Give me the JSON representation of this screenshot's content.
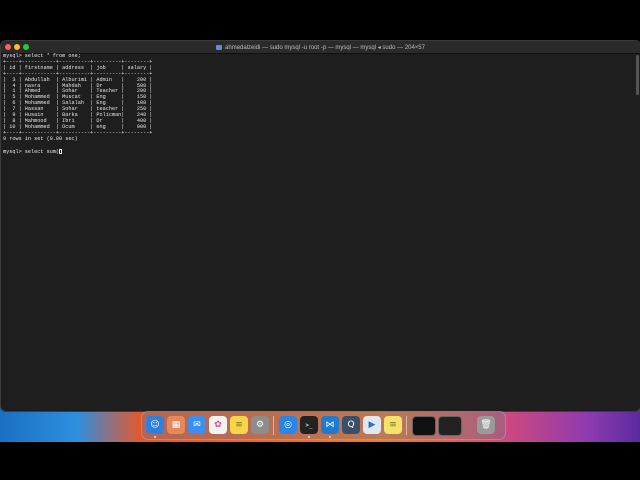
{
  "window": {
    "title": "ahmedalzeidi — sudo mysql -u root -p — mysql — mysql ◂ sudo — 204×57"
  },
  "terminal": {
    "lines": [
      "mysql> select * from one;",
      "+----+-----------+----------+---------+--------+",
      "| id | firstname | address  | job     | salary |",
      "+----+-----------+----------+---------+--------+",
      "|  3 | Abdullah  | Alburimi | Admin   |    200 |",
      "|  4 | nasra     | Mahdah   | Dr      |    500 |",
      "|  1 | Ahmed     | Sohar    | Teacher |    200 |",
      "|  5 | Mohammed  | Muscat   | Eng     |    150 |",
      "|  6 | Mohammed  | Salalah  | Eng     |    100 |",
      "|  7 | Hassan    | Sohar    | teacher |    250 |",
      "|  9 | Husain    | Barka    | Policman|    240 |",
      "|  8 | Mahmood   | Ibri     | Dr      |    400 |",
      "| 10 | Mohammed  | Dcum     | eng     |    900 |",
      "+----+-----------+----------+---------+--------+",
      "9 rows in set (0.00 sec)",
      "",
      "mysql> select sum("
    ]
  },
  "colors": {
    "terminal_bg": "#1e1e1e",
    "terminal_fg": "#e6e6e6",
    "close": "#ff5f57",
    "minimize": "#febc2e",
    "maximize": "#28c840"
  },
  "dock": {
    "items": [
      {
        "icon": "finder-icon",
        "color": "#2f7fe0",
        "glyph": "☺"
      },
      {
        "icon": "launchpad-icon",
        "color": "#e8875a",
        "glyph": "▦"
      },
      {
        "icon": "mail-icon",
        "color": "#3a8ff0",
        "glyph": "✉"
      },
      {
        "icon": "photos-icon",
        "color": "#f2f2f2",
        "glyph": "✿"
      },
      {
        "icon": "notes-icon",
        "color": "#f7d54a",
        "glyph": "≡"
      },
      {
        "icon": "system-settings-icon",
        "color": "#8d8d8d",
        "glyph": "⚙"
      },
      {
        "icon": "safari-icon",
        "color": "#2a86e6",
        "glyph": "◎"
      },
      {
        "icon": "terminal-icon",
        "color": "#222222",
        "glyph": ">_"
      },
      {
        "icon": "vscode-icon",
        "color": "#1f7ad1",
        "glyph": "⋈"
      },
      {
        "icon": "quicktime-icon",
        "color": "#3b4f6b",
        "glyph": "Q"
      },
      {
        "icon": "preview-icon",
        "color": "#dfe7f2",
        "glyph": "▶"
      },
      {
        "icon": "stickies-icon",
        "color": "#f3e36b",
        "glyph": "≡"
      },
      {
        "icon": "terminal-window-icon",
        "color": "#111111",
        "glyph": ""
      },
      {
        "icon": "terminal-window-icon-2",
        "color": "#222222",
        "glyph": ""
      },
      {
        "icon": "trash-icon",
        "color": "#9a9a9a",
        "glyph": "🗑"
      }
    ]
  }
}
